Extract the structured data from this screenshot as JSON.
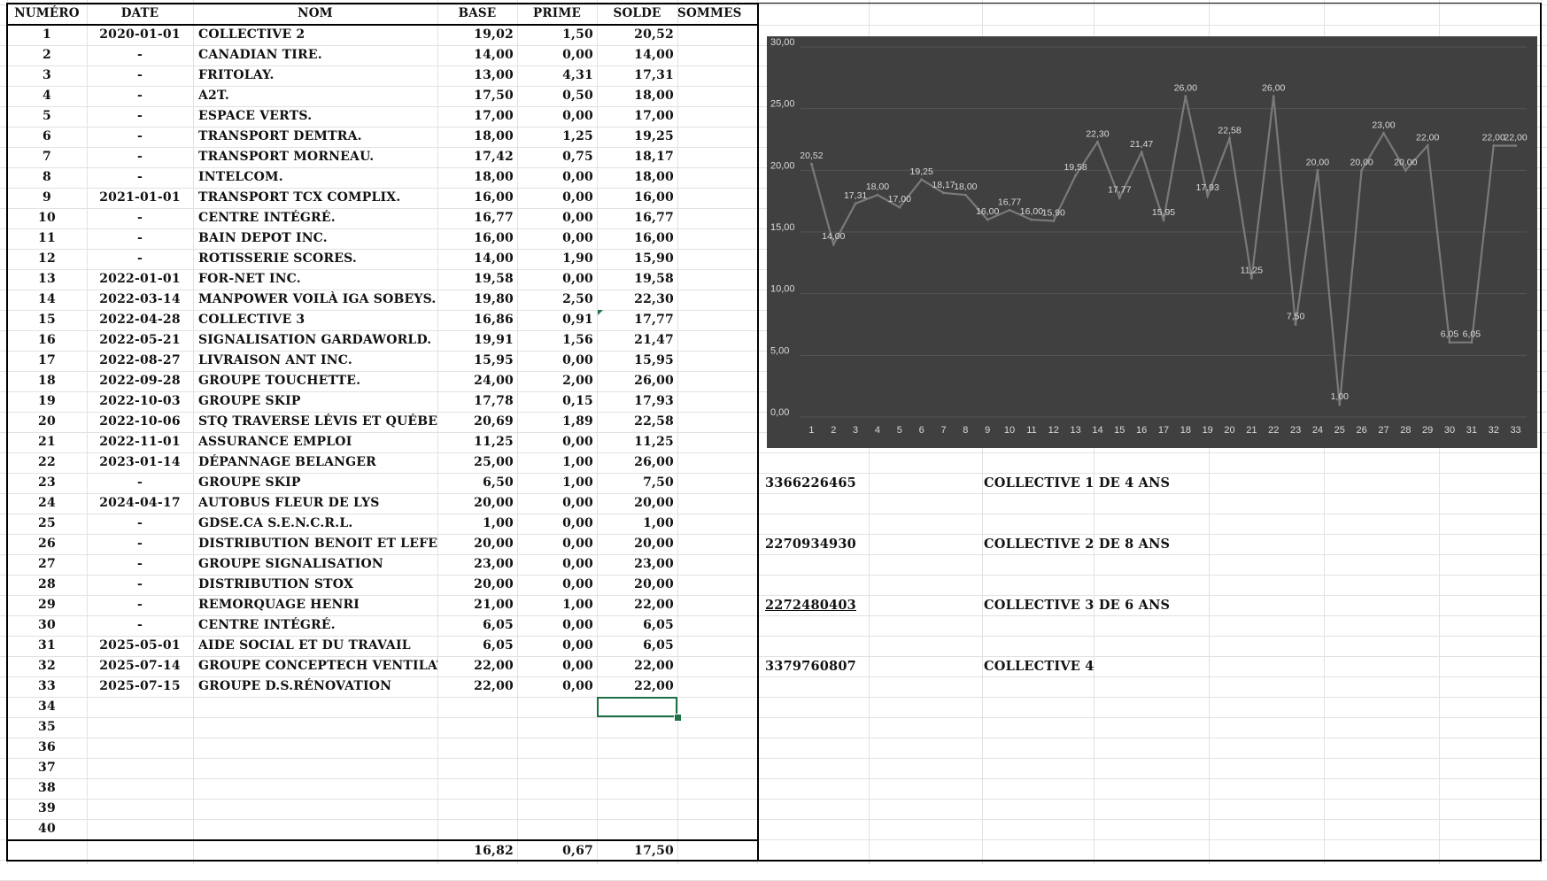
{
  "headers": {
    "numero": "NUMÉRO",
    "date": "DATE",
    "nom": "NOM",
    "base": "BASE",
    "prime": "PRIME",
    "solde": "SOLDE",
    "sommes": "SOMMES"
  },
  "rows": [
    {
      "n": "1",
      "date": "2020-01-01",
      "nom": "COLLECTIVE 2",
      "base": "19,02",
      "prime": "1,50",
      "solde": "20,52"
    },
    {
      "n": "2",
      "date": "-",
      "nom": "CANADIAN TIRE.",
      "base": "14,00",
      "prime": "0,00",
      "solde": "14,00"
    },
    {
      "n": "3",
      "date": "-",
      "nom": "FRITOLAY.",
      "base": "13,00",
      "prime": "4,31",
      "solde": "17,31"
    },
    {
      "n": "4",
      "date": "-",
      "nom": "A2T.",
      "base": "17,50",
      "prime": "0,50",
      "solde": "18,00"
    },
    {
      "n": "5",
      "date": "-",
      "nom": "ESPACE VERTS.",
      "base": "17,00",
      "prime": "0,00",
      "solde": "17,00"
    },
    {
      "n": "6",
      "date": "-",
      "nom": "TRANSPORT DEMTRA.",
      "base": "18,00",
      "prime": "1,25",
      "solde": "19,25"
    },
    {
      "n": "7",
      "date": "-",
      "nom": "TRANSPORT MORNEAU.",
      "base": "17,42",
      "prime": "0,75",
      "solde": "18,17"
    },
    {
      "n": "8",
      "date": "-",
      "nom": "INTELCOM.",
      "base": "18,00",
      "prime": "0,00",
      "solde": "18,00"
    },
    {
      "n": "9",
      "date": "2021-01-01",
      "nom": "TRANSPORT TCX COMPLIX.",
      "base": "16,00",
      "prime": "0,00",
      "solde": "16,00"
    },
    {
      "n": "10",
      "date": "-",
      "nom": "CENTRE INTÉGRÉ.",
      "base": "16,77",
      "prime": "0,00",
      "solde": "16,77"
    },
    {
      "n": "11",
      "date": "-",
      "nom": "BAIN DEPOT INC.",
      "base": "16,00",
      "prime": "0,00",
      "solde": "16,00"
    },
    {
      "n": "12",
      "date": "-",
      "nom": "ROTISSERIE SCORES.",
      "base": "14,00",
      "prime": "1,90",
      "solde": "15,90"
    },
    {
      "n": "13",
      "date": "2022-01-01",
      "nom": "FOR-NET INC.",
      "base": "19,58",
      "prime": "0,00",
      "solde": "19,58"
    },
    {
      "n": "14",
      "date": "2022-03-14",
      "nom": "MANPOWER VOILÀ IGA SOBEYS.",
      "base": "19,80",
      "prime": "2,50",
      "solde": "22,30"
    },
    {
      "n": "15",
      "date": "2022-04-28",
      "nom": "COLLECTIVE 3",
      "base": "16,86",
      "prime": "0,91",
      "solde": "17,77"
    },
    {
      "n": "16",
      "date": "2022-05-21",
      "nom": "SIGNALISATION GARDAWORLD.",
      "base": "19,91",
      "prime": "1,56",
      "solde": "21,47"
    },
    {
      "n": "17",
      "date": "2022-08-27",
      "nom": "LIVRAISON ANT INC.",
      "base": "15,95",
      "prime": "0,00",
      "solde": "15,95"
    },
    {
      "n": "18",
      "date": "2022-09-28",
      "nom": "GROUPE TOUCHETTE.",
      "base": "24,00",
      "prime": "2,00",
      "solde": "26,00"
    },
    {
      "n": "19",
      "date": "2022-10-03",
      "nom": "GROUPE SKIP",
      "base": "17,78",
      "prime": "0,15",
      "solde": "17,93"
    },
    {
      "n": "20",
      "date": "2022-10-06",
      "nom": "STQ TRAVERSE LÉVIS ET QUÉBEC",
      "base": "20,69",
      "prime": "1,89",
      "solde": "22,58"
    },
    {
      "n": "21",
      "date": "2022-11-01",
      "nom": "ASSURANCE EMPLOI",
      "base": "11,25",
      "prime": "0,00",
      "solde": "11,25"
    },
    {
      "n": "22",
      "date": "2023-01-14",
      "nom": "DÉPANNAGE BELANGER",
      "base": "25,00",
      "prime": "1,00",
      "solde": "26,00"
    },
    {
      "n": "23",
      "date": "-",
      "nom": "GROUPE SKIP",
      "base": "6,50",
      "prime": "1,00",
      "solde": "7,50"
    },
    {
      "n": "24",
      "date": "2024-04-17",
      "nom": "AUTOBUS FLEUR DE LYS",
      "base": "20,00",
      "prime": "0,00",
      "solde": "20,00"
    },
    {
      "n": "25",
      "date": "-",
      "nom": "GDSE.CA S.E.N.C.R.L.",
      "base": "1,00",
      "prime": "0,00",
      "solde": "1,00"
    },
    {
      "n": "26",
      "date": "-",
      "nom": "DISTRIBUTION BENOIT ET LEFEBVRE",
      "base": "20,00",
      "prime": "0,00",
      "solde": "20,00"
    },
    {
      "n": "27",
      "date": "-",
      "nom": "GROUPE SIGNALISATION",
      "base": "23,00",
      "prime": "0,00",
      "solde": "23,00"
    },
    {
      "n": "28",
      "date": "-",
      "nom": "DISTRIBUTION STOX",
      "base": "20,00",
      "prime": "0,00",
      "solde": "20,00"
    },
    {
      "n": "29",
      "date": "-",
      "nom": "REMORQUAGE HENRI",
      "base": "21,00",
      "prime": "1,00",
      "solde": "22,00"
    },
    {
      "n": "30",
      "date": "-",
      "nom": "CENTRE INTÉGRÉ.",
      "base": "6,05",
      "prime": "0,00",
      "solde": "6,05"
    },
    {
      "n": "31",
      "date": "2025-05-01",
      "nom": "AIDE SOCIAL ET DU TRAVAIL",
      "base": "6,05",
      "prime": "0,00",
      "solde": "6,05"
    },
    {
      "n": "32",
      "date": "2025-07-14",
      "nom": "GROUPE CONCEPTECH VENTILATION",
      "base": "22,00",
      "prime": "0,00",
      "solde": "22,00"
    },
    {
      "n": "33",
      "date": "2025-07-15",
      "nom": "GROUPE D.S.RÉNOVATION",
      "base": "22,00",
      "prime": "0,00",
      "solde": "22,00"
    },
    {
      "n": "34",
      "date": "",
      "nom": "",
      "base": "",
      "prime": "",
      "solde": ""
    },
    {
      "n": "35",
      "date": "",
      "nom": "",
      "base": "",
      "prime": "",
      "solde": ""
    },
    {
      "n": "36",
      "date": "",
      "nom": "",
      "base": "",
      "prime": "",
      "solde": ""
    },
    {
      "n": "37",
      "date": "",
      "nom": "",
      "base": "",
      "prime": "",
      "solde": ""
    },
    {
      "n": "38",
      "date": "",
      "nom": "",
      "base": "",
      "prime": "",
      "solde": ""
    },
    {
      "n": "39",
      "date": "",
      "nom": "",
      "base": "",
      "prime": "",
      "solde": ""
    },
    {
      "n": "40",
      "date": "",
      "nom": "",
      "base": "",
      "prime": "",
      "solde": ""
    }
  ],
  "totals": {
    "base": "16,82",
    "prime": "0,67",
    "solde": "17,50"
  },
  "side_entries": [
    {
      "number": "3366226465",
      "label": "COLLECTIVE 1 DE 4 ANS",
      "underline": false
    },
    {
      "number": "2270934930",
      "label": "COLLECTIVE 2 DE 8 ANS",
      "underline": false
    },
    {
      "number": "2272480403",
      "label": "COLLECTIVE 3 DE 6 ANS",
      "underline": true
    },
    {
      "number": "3379760807",
      "label": "COLLECTIVE 4",
      "underline": false
    }
  ],
  "chart_data": {
    "type": "line",
    "title": "",
    "xlabel": "",
    "ylabel": "",
    "x": [
      1,
      2,
      3,
      4,
      5,
      6,
      7,
      8,
      9,
      10,
      11,
      12,
      13,
      14,
      15,
      16,
      17,
      18,
      19,
      20,
      21,
      22,
      23,
      24,
      25,
      26,
      27,
      28,
      29,
      30,
      31,
      32,
      33
    ],
    "values": [
      20.52,
      14.0,
      17.31,
      18.0,
      17.0,
      19.25,
      18.17,
      18.0,
      16.0,
      16.77,
      16.0,
      15.9,
      19.58,
      22.3,
      17.77,
      21.47,
      15.95,
      26.0,
      17.93,
      22.58,
      11.25,
      26.0,
      7.5,
      20.0,
      1.0,
      20.0,
      23.0,
      20.0,
      22.0,
      6.05,
      6.05,
      22.0,
      22.0
    ],
    "labels": [
      "20,52",
      "14,00",
      "17,31",
      "18,00",
      "17,00",
      "19,25",
      "18,17",
      "18,00",
      "16,00",
      "16,77",
      "16,00",
      "15,90",
      "19,58",
      "22,30",
      "17,77",
      "21,47",
      "15,95",
      "26,00",
      "17,93",
      "22,58",
      "11,25",
      "26,00",
      "7,50",
      "20,00",
      "1,00",
      "20,00",
      "23,00",
      "20,00",
      "22,00",
      "6,05",
      "6,05",
      "22,00",
      "22,00"
    ],
    "y_ticks": [
      "0,00",
      "5,00",
      "10,00",
      "15,00",
      "20,00",
      "25,00",
      "30,00"
    ],
    "ylim": [
      0,
      30
    ],
    "grid": true,
    "colors": {
      "background": "#404040",
      "line": "#7a7a7a",
      "text": "#d9d9d9",
      "grid": "#555555"
    }
  }
}
